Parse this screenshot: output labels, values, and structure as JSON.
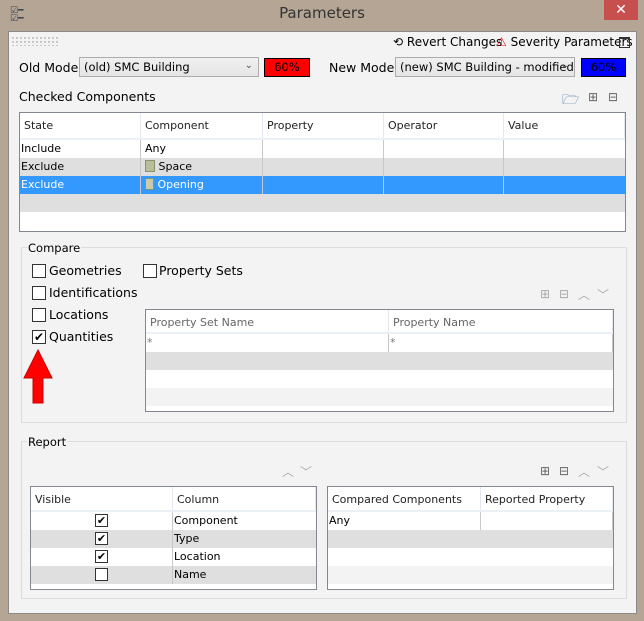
{
  "window": {
    "title": "Parameters",
    "close": "✕"
  },
  "toolbar": {
    "revert": "Revert Changes",
    "severity": "Severity Parameters"
  },
  "models": {
    "old_label": "Old Model",
    "old_value": "(old) SMC Building",
    "old_pct": "60%",
    "old_color": "#ff0000",
    "new_label": "New Model",
    "new_value": "(new) SMC Building - modified",
    "new_pct": "60%",
    "new_color": "#0000ff"
  },
  "checked": {
    "title": "Checked Components",
    "columns": [
      "State",
      "Component",
      "Property",
      "Operator",
      "Value"
    ],
    "rows": [
      {
        "state": "Include",
        "component": "Any"
      },
      {
        "state": "Exclude",
        "component": "Space"
      },
      {
        "state": "Exclude",
        "component": "Opening"
      }
    ]
  },
  "compare": {
    "title": "Compare",
    "geometries": "Geometries",
    "identifications": "Identifications",
    "locations": "Locations",
    "quantities": "Quantities",
    "property_sets": "Property Sets",
    "checked": {
      "geometries": false,
      "identifications": false,
      "locations": false,
      "quantities": true,
      "property_sets": false
    },
    "columns": [
      "Property Set Name",
      "Property Name"
    ],
    "rows": [
      [
        "*",
        "*"
      ]
    ]
  },
  "report": {
    "title": "Report",
    "left_columns": [
      "Visible",
      "Column"
    ],
    "left_rows": [
      {
        "visible": true,
        "column": "Component"
      },
      {
        "visible": true,
        "column": "Type"
      },
      {
        "visible": true,
        "column": "Location"
      },
      {
        "visible": false,
        "column": "Name"
      }
    ],
    "right_columns": [
      "Compared Components",
      "Reported Property"
    ],
    "right_rows": [
      [
        "Any",
        ""
      ]
    ]
  }
}
